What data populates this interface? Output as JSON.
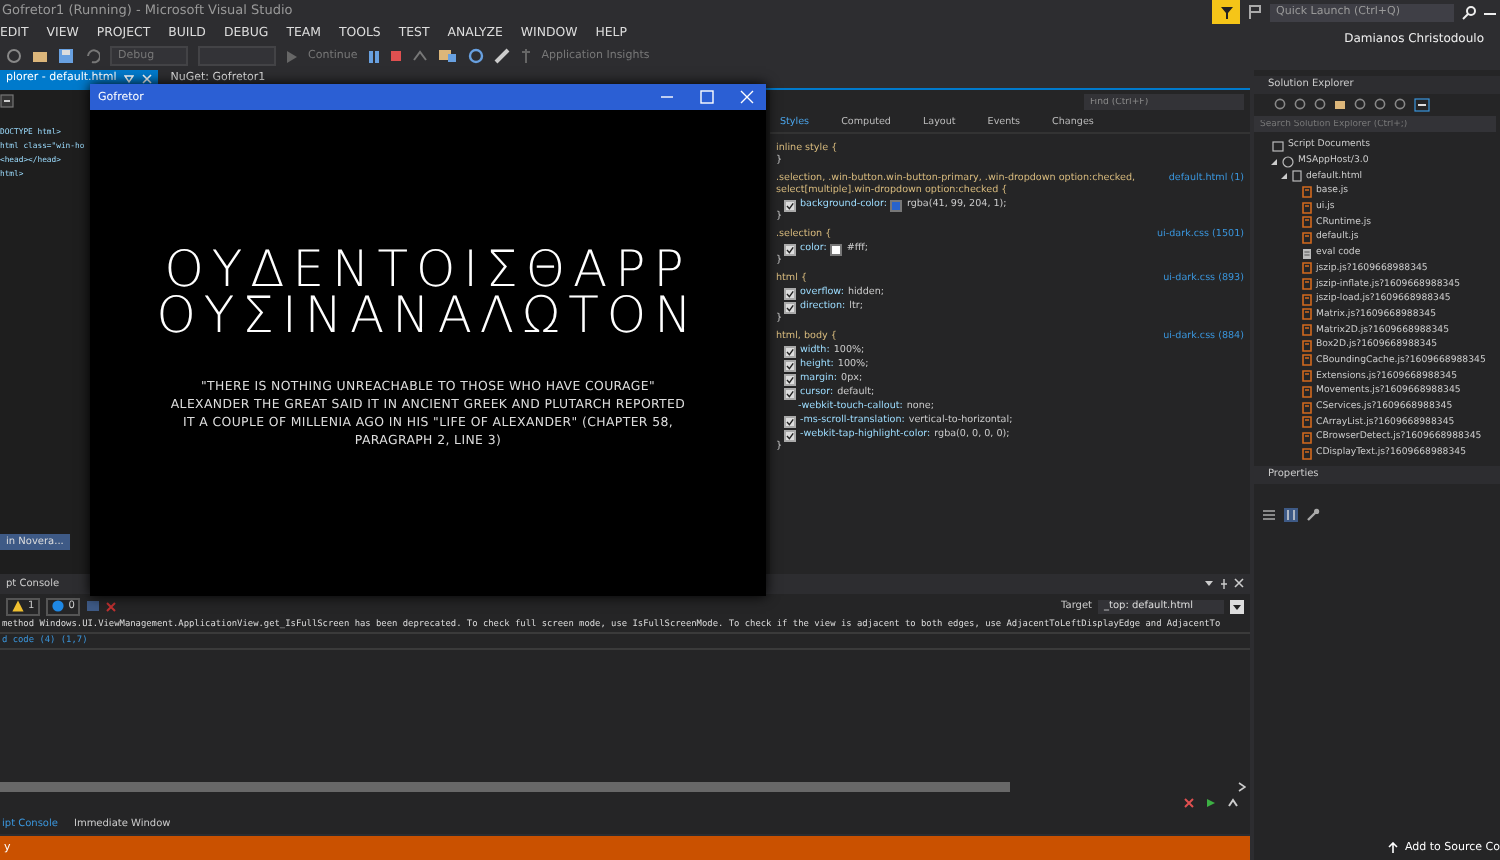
{
  "window": {
    "title": "Gofretor1 (Running) - Microsoft Visual Studio"
  },
  "quick_launch": {
    "placeholder": "Quick Launch (Ctrl+Q)"
  },
  "user": "Damianos Christodoulo",
  "menu": [
    "EDIT",
    "VIEW",
    "PROJECT",
    "BUILD",
    "DEBUG",
    "TEAM",
    "TOOLS",
    "TEST",
    "ANALYZE",
    "WINDOW",
    "HELP"
  ],
  "toolbar": {
    "configuration": "Debug",
    "continue": "Continue",
    "insights": "Application Insights"
  },
  "document_tabs": [
    {
      "label": "plorer - default.html",
      "selected": true
    },
    {
      "label": "NuGet: Gofretor1",
      "selected": false
    }
  ],
  "editor": {
    "lines": [
      "DOCTYPE html>",
      "html class=\"win-ho",
      "<head></head>",
      "html>"
    ],
    "chip": "in Novera..."
  },
  "app_window": {
    "title": "Gofretor",
    "inscription": [
      "ΟΥΔΕΝΤΟΙΣΘΑΡΡ",
      "ΟΥΣΙΝΑΝΑΛΩΤΟΝ"
    ],
    "quote": "\"THERE IS NOTHING UNREACHABLE TO THOSE WHO HAVE COURAGE\" ALEXANDER THE GREAT SAID IT IN ANCIENT GREEK AND PLUTARCH REPORTED IT A COUPLE OF MILLENIA AGO IN HIS \"LIFE OF ALEXANDER\" (CHAPTER 58, PARAGRAPH 2, LINE 3)"
  },
  "dom_explorer": {
    "find": {
      "placeholder": "Find (Ctrl+F)"
    },
    "tabs": [
      {
        "label": "Styles",
        "selected": true
      },
      {
        "label": "Computed",
        "selected": false
      },
      {
        "label": "Layout",
        "selected": false
      },
      {
        "label": "Events",
        "selected": false
      },
      {
        "label": "Changes",
        "selected": false
      }
    ],
    "rules": [
      {
        "selector": "inline style {",
        "close": "}"
      },
      {
        "selector": ".selection, .win-button.win-button-primary, .win-dropdown option:checked, select[multiple].win-dropdown option:checked {",
        "source": "default.html (1)",
        "close": "}",
        "declarations": [
          {
            "kind": "toggle",
            "checked": true,
            "property": "background-color:",
            "value": "rgba(41, 99, 204, 1);",
            "color": "#2963cc"
          }
        ]
      },
      {
        "selector": ".selection {",
        "source": "ui-dark.css (1501)",
        "close": "}",
        "declarations": [
          {
            "kind": "toggle",
            "checked": true,
            "property": "color:",
            "value": "#fff;",
            "color": "#ffffff"
          }
        ]
      },
      {
        "selector": "html {",
        "source": "ui-dark.css (893)",
        "close": "}",
        "declarations": [
          {
            "kind": "toggle",
            "checked": true,
            "property": "overflow:",
            "value": "hidden;"
          },
          {
            "kind": "toggle",
            "checked": true,
            "property": "direction:",
            "value": "ltr;"
          }
        ]
      },
      {
        "selector": "html, body {",
        "source": "ui-dark.css (884)",
        "close": "}",
        "declarations": [
          {
            "kind": "toggle",
            "checked": true,
            "property": "width:",
            "value": "100%;"
          },
          {
            "kind": "toggle",
            "checked": true,
            "property": "height:",
            "value": "100%;"
          },
          {
            "kind": "toggle",
            "checked": true,
            "property": "margin:",
            "value": "0px;"
          },
          {
            "kind": "toggle",
            "checked": true,
            "property": "cursor:",
            "value": "default;"
          },
          {
            "kind": "plain",
            "property": "-webkit-touch-callout:",
            "value": "none;"
          },
          {
            "kind": "toggle",
            "checked": true,
            "property": "-ms-scroll-translation:",
            "value": "vertical-to-horizontal;"
          },
          {
            "kind": "toggle",
            "checked": true,
            "property": "-webkit-tap-highlight-color:",
            "value": "rgba(0, 0, 0, 0);"
          }
        ]
      }
    ]
  },
  "console": {
    "title": "pt Console",
    "warnings": "1",
    "infos": "0",
    "target_label": "Target",
    "target": "_top: default.html",
    "messages": [
      {
        "kind": "warning",
        "text": "method Windows.UI.ViewManagement.ApplicationView.get_IsFullScreen has been deprecated. To check full screen mode, use IsFullScreenMode. To check if the view is adjacent to both edges, use AdjacentToLeftDisplayEdge and AdjacentTo"
      },
      {
        "kind": "link",
        "text": "d code (4) (1,7)"
      }
    ],
    "tabs": [
      {
        "label": "ipt Console",
        "selected": true
      },
      {
        "label": "Immediate Window",
        "selected": false
      }
    ]
  },
  "solution_explorer": {
    "title": "Solution Explorer",
    "search": {
      "placeholder": "Search Solution Explorer (Ctrl+;)"
    },
    "tree": [
      {
        "label": "Script Documents",
        "kind": "folder",
        "children": [
          {
            "label": "MSAppHost/3.0",
            "kind": "host",
            "expanded": true,
            "children": [
              {
                "label": "default.html",
                "kind": "html",
                "expanded": true,
                "children": [
                  {
                    "label": "base.js",
                    "kind": "js"
                  },
                  {
                    "label": "ui.js",
                    "kind": "js"
                  },
                  {
                    "label": "CRuntime.js",
                    "kind": "js"
                  },
                  {
                    "label": "default.js",
                    "kind": "js"
                  },
                  {
                    "label": "eval code",
                    "kind": "eval"
                  },
                  {
                    "label": "jszip.js?1609668988345",
                    "kind": "js"
                  },
                  {
                    "label": "jszip-inflate.js?1609668988345",
                    "kind": "js"
                  },
                  {
                    "label": "jszip-load.js?1609668988345",
                    "kind": "js"
                  },
                  {
                    "label": "Matrix.js?1609668988345",
                    "kind": "js"
                  },
                  {
                    "label": "Matrix2D.js?1609668988345",
                    "kind": "js"
                  },
                  {
                    "label": "Box2D.js?1609668988345",
                    "kind": "js"
                  },
                  {
                    "label": "CBoundingCache.js?1609668988345",
                    "kind": "js"
                  },
                  {
                    "label": "Extensions.js?1609668988345",
                    "kind": "js"
                  },
                  {
                    "label": "Movements.js?1609668988345",
                    "kind": "js"
                  },
                  {
                    "label": "CServices.js?1609668988345",
                    "kind": "js"
                  },
                  {
                    "label": "CArrayList.js?1609668988345",
                    "kind": "js"
                  },
                  {
                    "label": "CBrowserDetect.js?1609668988345",
                    "kind": "js"
                  },
                  {
                    "label": "CDisplayText.js?1609668988345",
                    "kind": "js"
                  }
                ]
              }
            ]
          }
        ]
      }
    ]
  },
  "properties": {
    "title": "Properties"
  },
  "status_bar": {
    "left": "y",
    "right": "Add to Source Co"
  }
}
